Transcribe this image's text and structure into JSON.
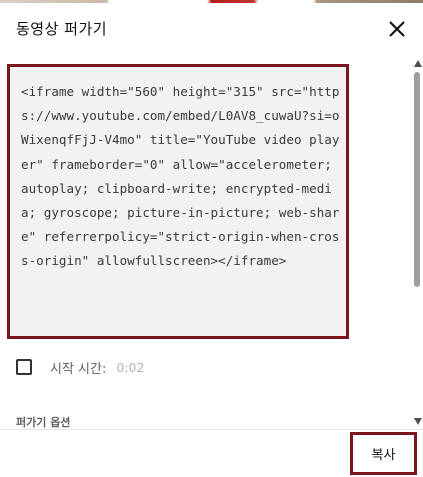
{
  "dialog": {
    "title": "동영상 퍼가기",
    "close_icon": "close-icon"
  },
  "embed": {
    "code": "<iframe width=\"560\" height=\"315\" src=\"https://www.youtube.com/embed/L0AV8_cuwaU?si=oWixenqfFjJ-V4mo\" title=\"YouTube video player\" frameborder=\"0\" allow=\"accelerometer; autoplay; clipboard-write; encrypted-media; gyroscope; picture-in-picture; web-share\" referrerpolicy=\"strict-origin-when-cross-origin\" allowfullscreen></iframe>"
  },
  "start_time": {
    "label": "시작 시간:",
    "value": "0:02",
    "checked": false
  },
  "options": {
    "label": "퍼가기 옵션"
  },
  "footer": {
    "copy_label": "복사"
  },
  "colors": {
    "highlight_border": "#7b1620",
    "code_background": "#f2f2f2"
  }
}
